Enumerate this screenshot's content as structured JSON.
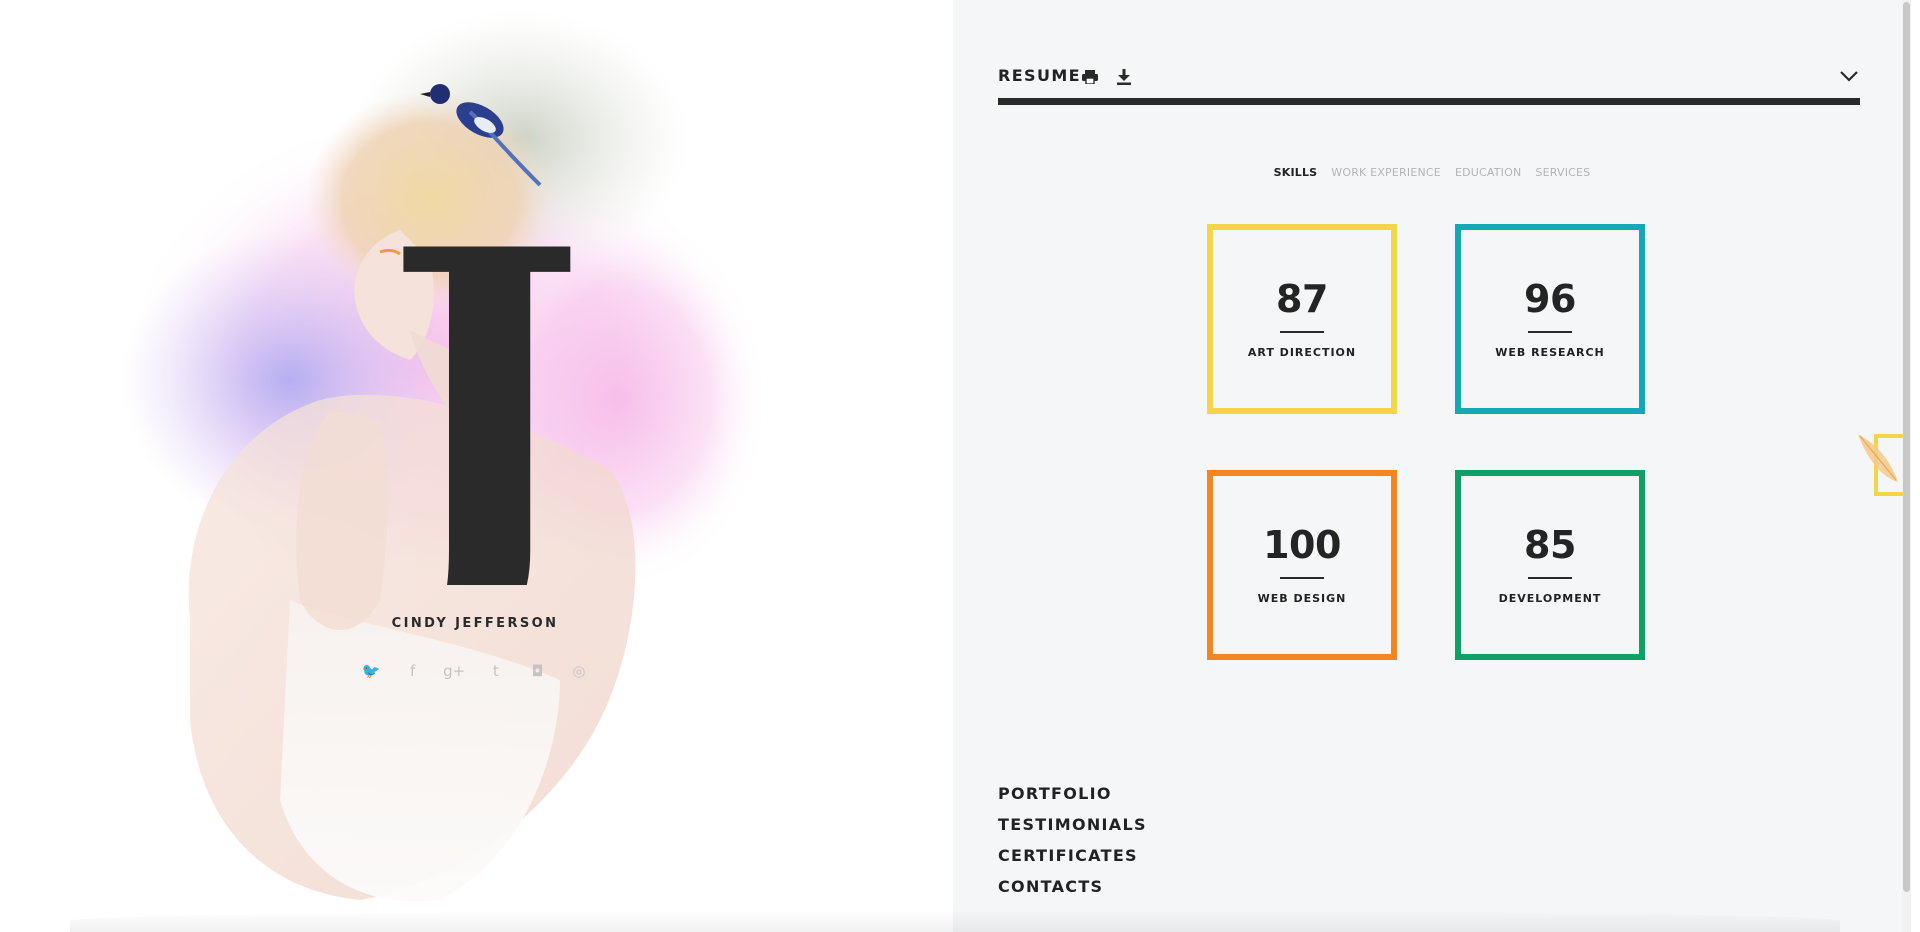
{
  "profile": {
    "monogram": "J",
    "name": "CINDY JEFFERSON",
    "socials": [
      {
        "icon": "twitter-icon",
        "glyph": "🐦"
      },
      {
        "icon": "facebook-icon",
        "glyph": "f"
      },
      {
        "icon": "google-plus-icon",
        "glyph": "g+"
      },
      {
        "icon": "tumblr-icon",
        "glyph": "t"
      },
      {
        "icon": "instagram-icon",
        "glyph": "◘"
      },
      {
        "icon": "dribbble-icon",
        "glyph": "◎"
      }
    ]
  },
  "resume": {
    "title": "RESUME",
    "print_icon": "print-icon",
    "download_icon": "download-icon",
    "collapse_icon": "chevron-down-icon"
  },
  "tabs": [
    {
      "label": "SKILLS",
      "active": true
    },
    {
      "label": "WORK EXPERIENCE",
      "active": false
    },
    {
      "label": "EDUCATION",
      "active": false
    },
    {
      "label": "SERVICES",
      "active": false
    }
  ],
  "skills": [
    {
      "value": "87",
      "label": "ART DIRECTION",
      "color": "#f4d547"
    },
    {
      "value": "96",
      "label": "WEB RESEARCH",
      "color": "#11a9b6"
    },
    {
      "value": "100",
      "label": "WEB DESIGN",
      "color": "#f5851f"
    },
    {
      "value": "85",
      "label": "DEVELOPMENT",
      "color": "#0fa065"
    }
  ],
  "nav": [
    {
      "label": "PORTFOLIO"
    },
    {
      "label": "TESTIMONIALS"
    },
    {
      "label": "CERTIFICATES"
    },
    {
      "label": "CONTACTS"
    }
  ],
  "colors": {
    "panel_bg": "#f5f6f7",
    "text_dark": "#222222",
    "tab_inactive": "#b4b4b4",
    "accent_yellow": "#f4d547"
  }
}
